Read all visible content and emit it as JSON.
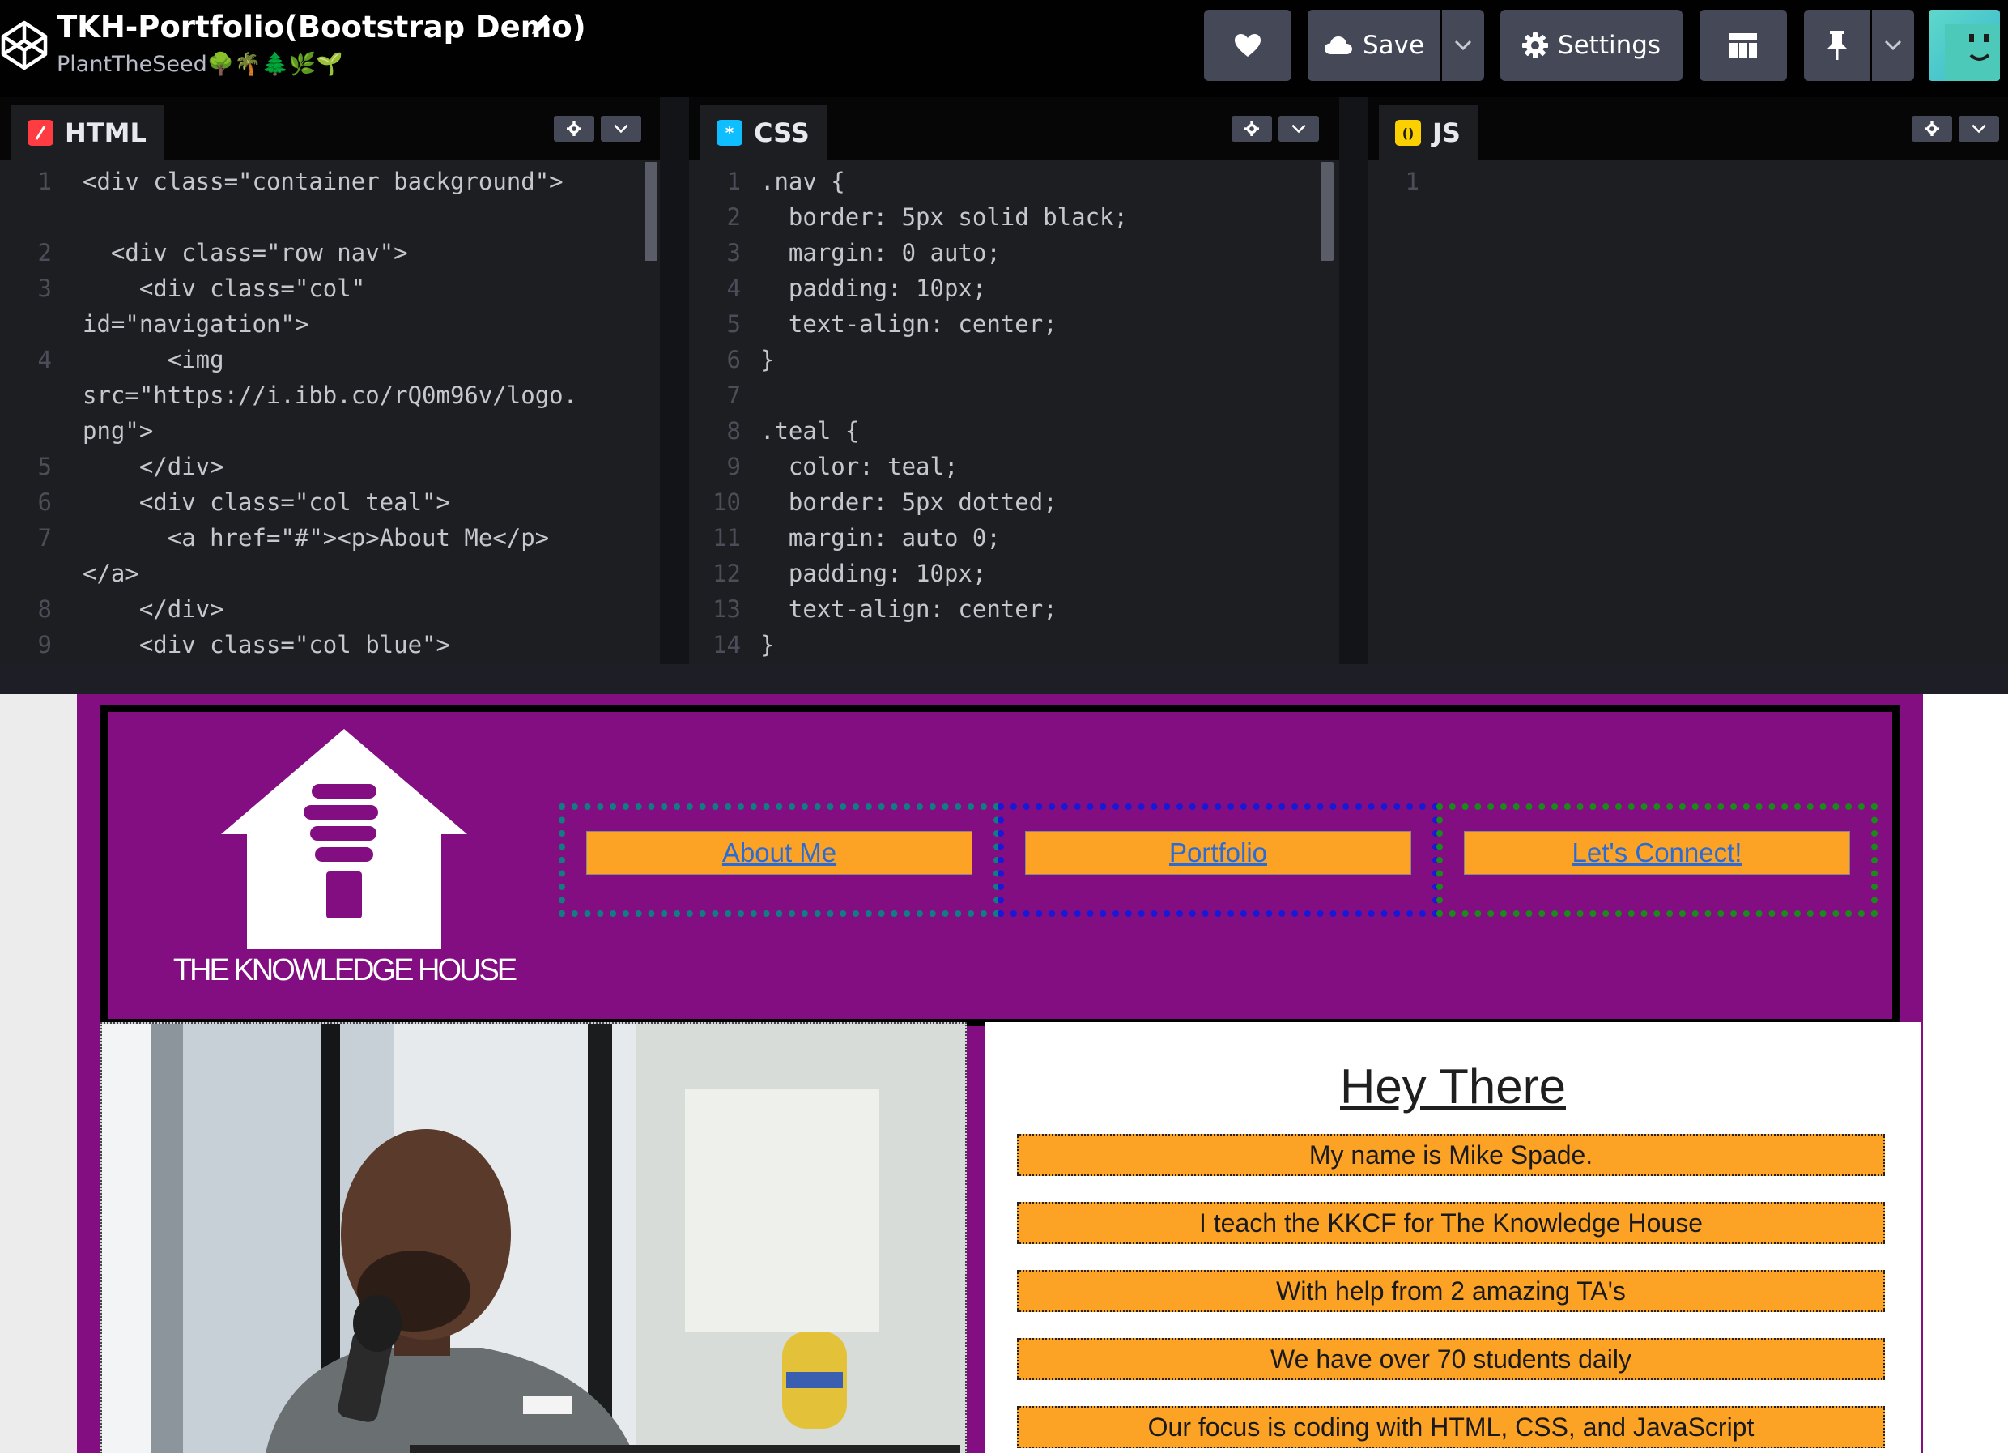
{
  "header": {
    "title": "TKH-Portfolio(Bootstrap Demo)",
    "author": "PlantTheSeed🌳🌴🌲🌿🌱",
    "buttons": {
      "heart_icon": "heart-icon",
      "save_label": "Save",
      "settings_label": "Settings",
      "layout_icon": "layout-icon",
      "pin_icon": "pin-icon"
    }
  },
  "editors": {
    "html": {
      "label": "HTML",
      "lines": [
        {
          "n": "1",
          "text": "<div class=\"container background\">"
        },
        {
          "n": "",
          "text": ""
        },
        {
          "n": "2",
          "text": "  <div class=\"row nav\">"
        },
        {
          "n": "3",
          "text": "    <div class=\"col\""
        },
        {
          "n": "",
          "text": "id=\"navigation\">"
        },
        {
          "n": "4",
          "text": "      <img"
        },
        {
          "n": "",
          "text": "src=\"https://i.ibb.co/rQ0m96v/logo."
        },
        {
          "n": "",
          "text": "png\">"
        },
        {
          "n": "5",
          "text": "    </div>"
        },
        {
          "n": "6",
          "text": "    <div class=\"col teal\">"
        },
        {
          "n": "7",
          "text": "      <a href=\"#\"><p>About Me</p>"
        },
        {
          "n": "",
          "text": "</a>"
        },
        {
          "n": "8",
          "text": "    </div>"
        },
        {
          "n": "9",
          "text": "    <div class=\"col blue\">"
        }
      ]
    },
    "css": {
      "label": "CSS",
      "lines": [
        {
          "n": "1",
          "text": ".nav {"
        },
        {
          "n": "2",
          "text": "  border: 5px solid black;"
        },
        {
          "n": "3",
          "text": "  margin: 0 auto;"
        },
        {
          "n": "4",
          "text": "  padding: 10px;"
        },
        {
          "n": "5",
          "text": "  text-align: center;"
        },
        {
          "n": "6",
          "text": "}"
        },
        {
          "n": "7",
          "text": ""
        },
        {
          "n": "8",
          "text": ".teal {"
        },
        {
          "n": "9",
          "text": "  color: teal;"
        },
        {
          "n": "10",
          "text": "  border: 5px dotted;"
        },
        {
          "n": "11",
          "text": "  margin: auto 0;"
        },
        {
          "n": "12",
          "text": "  padding: 10px;"
        },
        {
          "n": "13",
          "text": "  text-align: center;"
        },
        {
          "n": "14",
          "text": "}"
        }
      ]
    },
    "js": {
      "label": "JS",
      "lines": [
        {
          "n": "1",
          "text": ""
        }
      ]
    }
  },
  "preview": {
    "logo_text": "THE KNOWLEDGE HOUSE",
    "nav_links": [
      "About Me",
      "Portfolio",
      "Let's Connect!"
    ],
    "about": {
      "title": "Hey There",
      "lines": [
        "My name is Mike Spade.",
        "I teach the KKCF for The Knowledge House",
        "With help from 2 amazing TA's",
        "We have over 70 students daily",
        "Our focus is coding with HTML, CSS, and JavaScript"
      ]
    }
  },
  "colors": {
    "purple": "#820e82",
    "orange": "#fca326",
    "teal_border": "#117d82",
    "blue_border": "#1818d8",
    "green_border": "#1b8a1b"
  }
}
